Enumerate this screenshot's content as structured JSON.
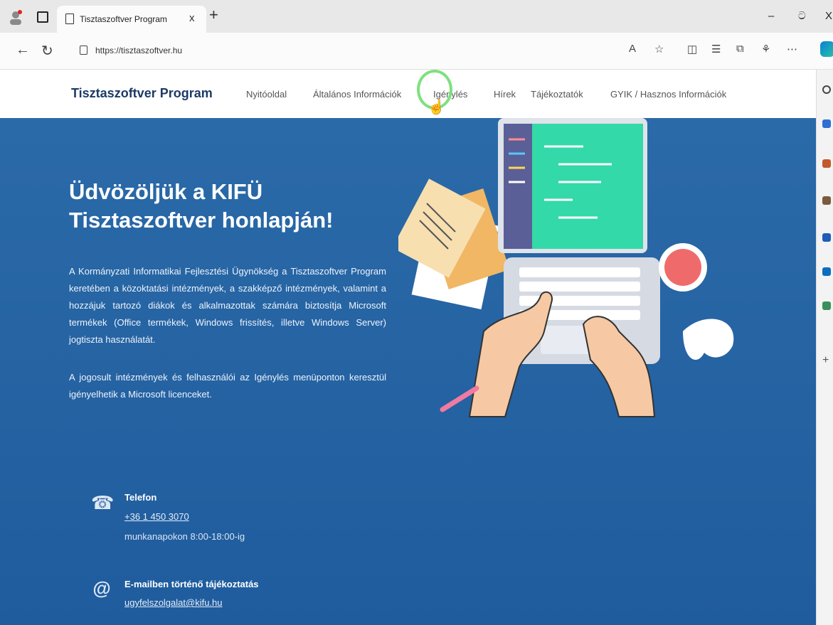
{
  "browser": {
    "tab_title": "Tisztaszoftver Program",
    "tab_close": "x",
    "new_tab": "+",
    "url": "https://tisztaszoftver.hu",
    "minimize": "–",
    "restore": "ට",
    "close": "X"
  },
  "site": {
    "brand": "Tisztaszoftver Program",
    "nav": [
      "Nyitóoldal",
      "Általános Információk",
      "Igénylés",
      "Hírek",
      "Tájékoztatók",
      "GYIK / Hasznos Információk"
    ]
  },
  "hero": {
    "title": "Üdvözöljük a KIFÜ Tisztaszoftver honlapján!",
    "p1": "A Kormányzati Informatikai Fejlesztési Ügynökség a Tisztaszoftver Program keretében a közoktatási intézmények, a szakképző intézmények, valamint a hozzájuk tartozó diákok és alkalmazottak számára biztosítja Microsoft termékek (Office termékek, Windows frissítés, illetve Windows Server) jogtiszta használatát.",
    "p2": "A jogosult intézmények és felhasználói az Igénylés menüponton keresztül igényelhetik a Microsoft licenceket."
  },
  "contact": {
    "phone_label": "Telefon",
    "phone_number": "+36 1 450 3070",
    "phone_hours": "munkanapokon 8:00-18:00-ig",
    "email_label": "E-mailben történő tájékoztatás",
    "email": "ugyfelszolgalat@kifu.hu"
  }
}
